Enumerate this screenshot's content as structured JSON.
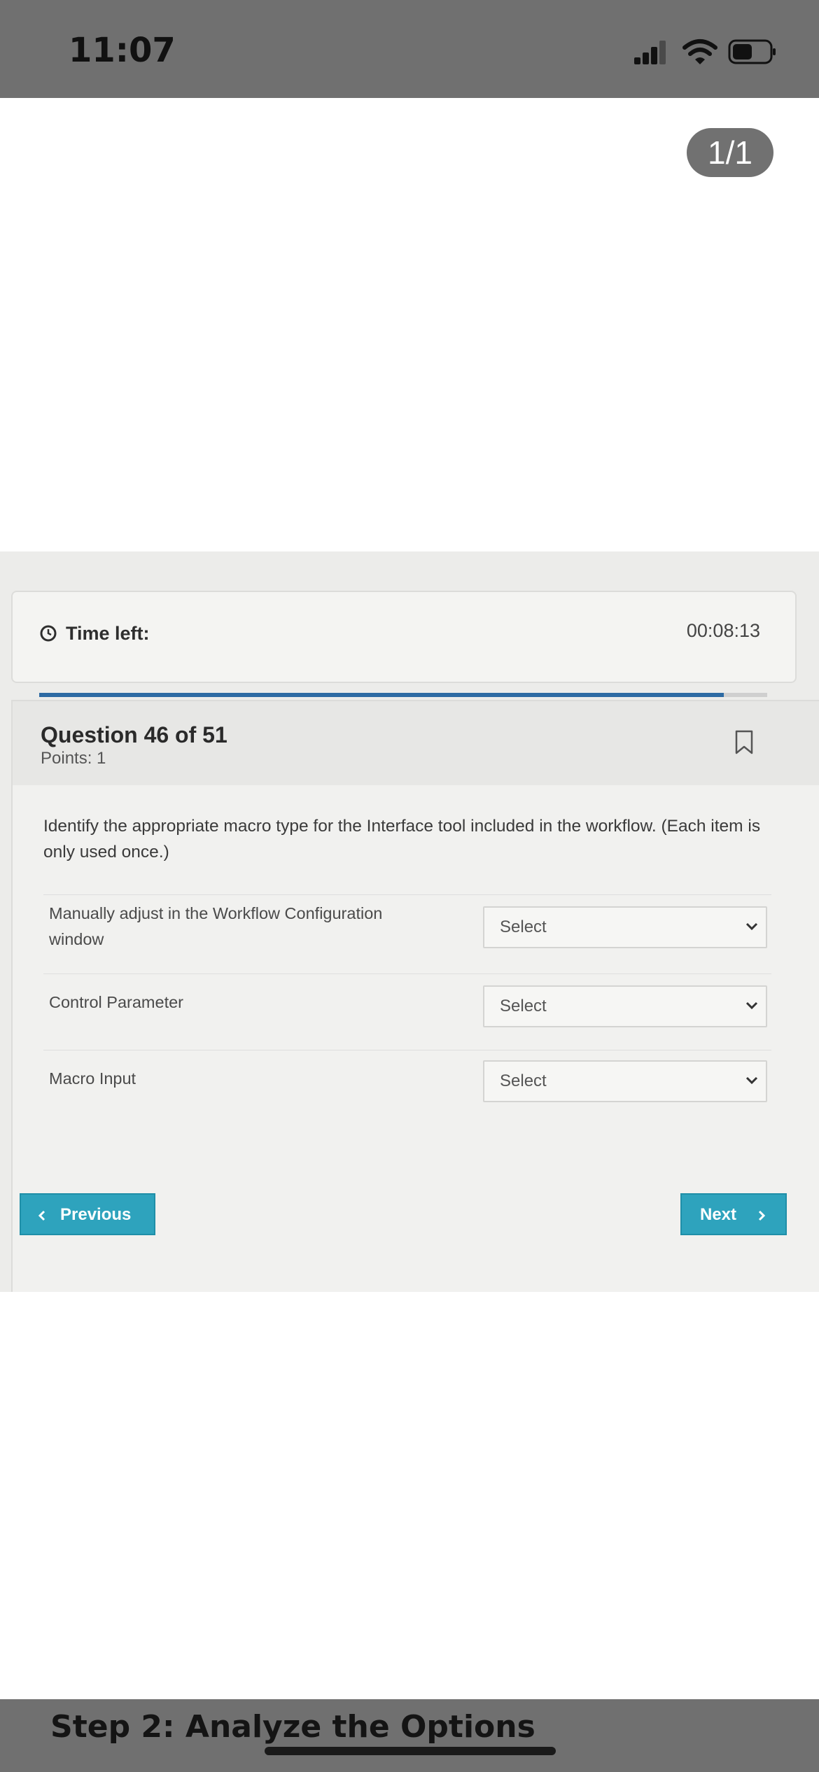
{
  "status_bar": {
    "time": "11:07"
  },
  "viewer": {
    "page_counter": "1/1"
  },
  "quiz": {
    "timer": {
      "label": "Time left:",
      "value": "00:08:13",
      "progress": 0.94
    },
    "question": {
      "title": "Question 46 of 51",
      "points": "Points: 1",
      "text": "Identify the appropriate macro type for the Interface tool included in the workflow. (Each item is only used once.)",
      "items": [
        {
          "label": "Manually adjust in the Workflow Configuration window",
          "selected": "Select"
        },
        {
          "label": "Control Parameter",
          "selected": "Select"
        },
        {
          "label": "Macro Input",
          "selected": "Select"
        }
      ]
    },
    "nav": {
      "previous": "Previous",
      "next": "Next"
    }
  },
  "banner": {
    "title": "Step 2: Analyze the Options"
  },
  "colors": {
    "accent": "#2ea3bd",
    "progress": "#2d6aa3",
    "status_bar": "#707070"
  }
}
